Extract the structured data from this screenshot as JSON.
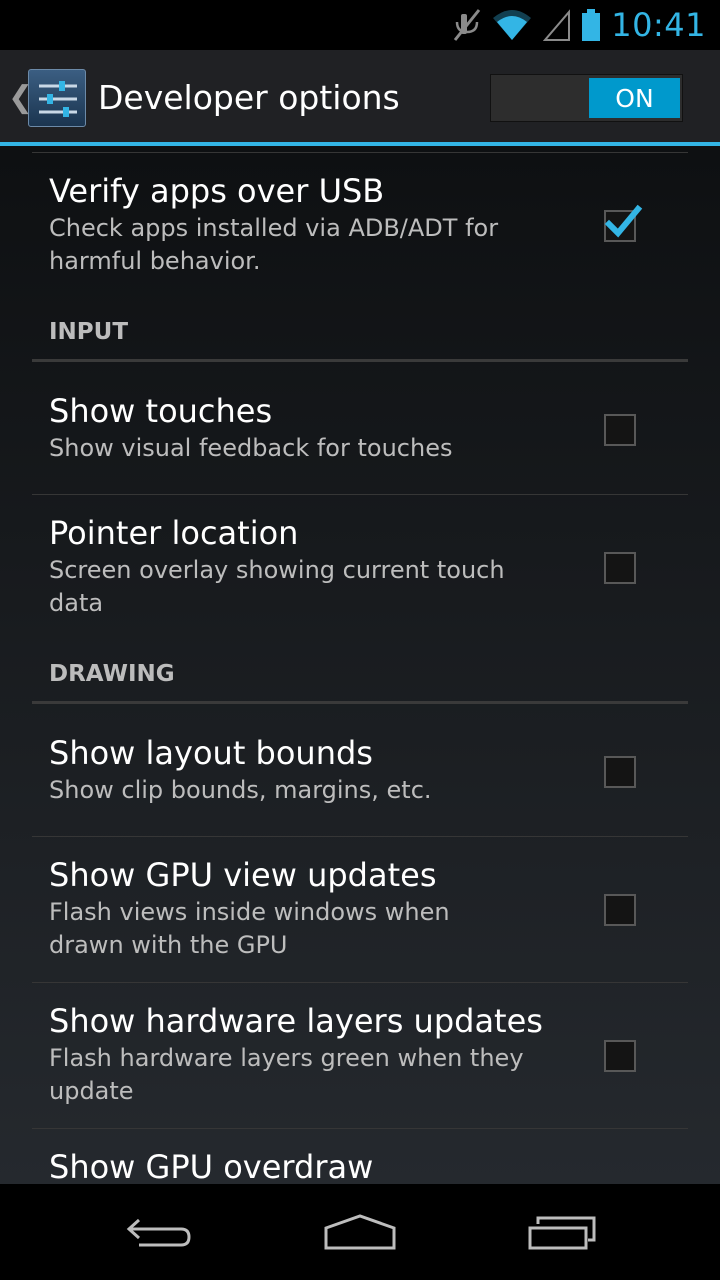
{
  "status_bar": {
    "time": "10:41",
    "icons": [
      "mute-icon",
      "wifi-icon",
      "signal-icon",
      "battery-icon"
    ]
  },
  "action_bar": {
    "title": "Developer options",
    "toggle_label": "ON",
    "toggle_state": "on",
    "accent_color": "#33b5e5"
  },
  "list": {
    "verify_apps": {
      "title": "Verify apps over USB",
      "summary_line1": "Check apps installed via ADB/ADT for",
      "summary_line2": "harmful behavior.",
      "checked": true
    },
    "input_header": "INPUT",
    "show_touches": {
      "title": "Show touches",
      "summary": "Show visual feedback for touches",
      "checked": false
    },
    "pointer_location": {
      "title": "Pointer location",
      "summary_line1": "Screen overlay showing current touch",
      "summary_line2": "data",
      "checked": false
    },
    "drawing_header": "DRAWING",
    "layout_bounds": {
      "title": "Show layout bounds",
      "summary": "Show clip bounds, margins, etc.",
      "checked": false
    },
    "gpu_view_updates": {
      "title": "Show GPU view updates",
      "summary_line1": "Flash views inside windows when",
      "summary_line2": "drawn with the GPU",
      "checked": false
    },
    "hw_layers_updates": {
      "title": "Show hardware layers updates",
      "summary_line1": "Flash hardware layers green when they",
      "summary_line2": "update",
      "checked": false
    },
    "gpu_overdraw": {
      "title": "Show GPU overdraw"
    }
  },
  "nav_bar": {
    "buttons": [
      "back-icon",
      "home-icon",
      "recents-icon"
    ]
  }
}
